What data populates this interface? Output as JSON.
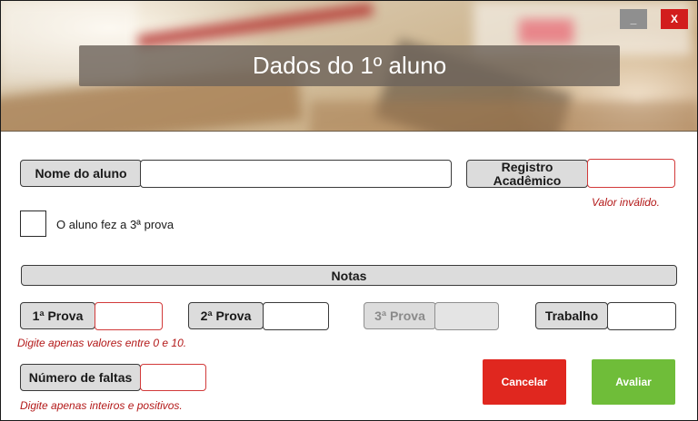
{
  "window": {
    "title": "Dados do 1º aluno",
    "minimize_label": "_",
    "close_label": "X"
  },
  "student": {
    "name_label": "Nome do aluno",
    "name_value": "",
    "ra_label": "Registro Acadêmico",
    "ra_value": "",
    "ra_error": "Valor inválido.",
    "third_exam_checkbox_label": "O aluno fez a 3ª prova",
    "third_exam_checked": false
  },
  "grades": {
    "section_label": "Notas",
    "exam1_label": "1ª Prova",
    "exam2_label": "2ª Prova",
    "exam3_label": "3ª Prova",
    "work_label": "Trabalho",
    "grades_error": "Digite apenas valores entre 0 e 10."
  },
  "absences": {
    "label": "Número de faltas",
    "error": "Digite apenas inteiros e positivos."
  },
  "actions": {
    "cancel_label": "Cancelar",
    "evaluate_label": "Avaliar"
  }
}
